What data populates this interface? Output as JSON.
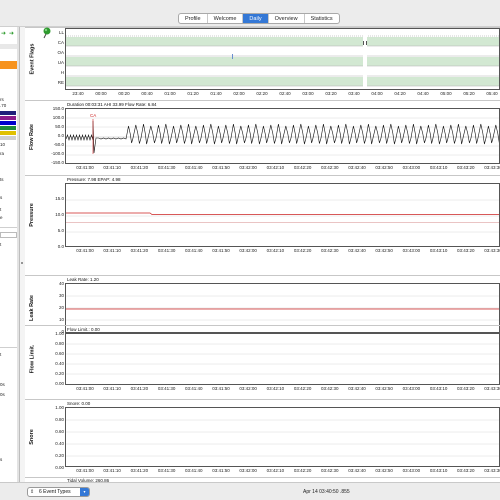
{
  "tabs": [
    "Profile",
    "Welcome",
    "Daily",
    "Overview",
    "Statistics"
  ],
  "active_tab": "Daily",
  "graphs": {
    "events": {
      "title": "Event Flags",
      "rows": [
        "LL",
        "CA",
        "OA",
        "UA",
        "H",
        "RE"
      ],
      "time_ticks": [
        "23:40",
        "00:00",
        "00:20",
        "00:40",
        "01:00",
        "01:20",
        "01:40",
        "02:00",
        "02:20",
        "02:40",
        "03:00",
        "03:20",
        "03:40",
        "04:00",
        "04:20",
        "04:40",
        "05:00",
        "05:20",
        "05:40"
      ]
    },
    "flow_rate": {
      "title": "Flow Rate",
      "info": "Duration 00:03:31 AHI 33.99 Flow Rate: 6.84",
      "yticks": [
        "150.0",
        "100.0",
        "50.0",
        "0.0",
        "-50.0",
        "-100.0",
        "-150.0"
      ],
      "event_label": "CA"
    },
    "pressure": {
      "title": "Pressure",
      "info": "Pressure: 7.98 EPAP: 4.98",
      "yticks": [
        "15.0",
        "10.0",
        "5.0",
        "0.0"
      ]
    },
    "leak_rate": {
      "title": "Leak Rate",
      "info": "Leak Rate: 1.20",
      "yticks": [
        "40",
        "30",
        "20",
        "10",
        "0"
      ]
    },
    "flow_limit": {
      "title": "Flow Limit.",
      "info": "Flow Limit.: 0.00",
      "yticks": [
        "1.00",
        "0.80",
        "0.60",
        "0.40",
        "0.20",
        "0.00"
      ]
    },
    "snore": {
      "title": "Snore",
      "info": "Snore: 0.00",
      "yticks": [
        "1.00",
        "0.80",
        "0.60",
        "0.40",
        "0.20",
        "0.00"
      ]
    },
    "tidal_volume": {
      "info": "Tidal Volume: 260.86"
    }
  },
  "x_ticks": [
    "03:41:00",
    "03:41:10",
    "03:41:20",
    "03:41:30",
    "03:41:40",
    "03:41:50",
    "03:42:00",
    "03:42:10",
    "03:42:20",
    "03:42:30",
    "03:42:40",
    "03:42:50",
    "03:43:00",
    "03:43:10",
    "03:43:20",
    "03:43:30"
  ],
  "left_panel": {
    "partial_texts": [
      "rs",
      ".70",
      "10",
      "ra",
      "ts",
      "s",
      "t",
      "e",
      "t",
      "t",
      "0s",
      "0s",
      "s"
    ]
  },
  "bottom": {
    "event_types": "6 Event Types",
    "status": "Apr 14 03:40:50 .855"
  },
  "colors": {
    "accent": "#3478d6",
    "flag_band": "#d2e8d2",
    "orange": "#f7931e",
    "pressure_line": "#cc2222",
    "leak_line": "#cc2222"
  }
}
